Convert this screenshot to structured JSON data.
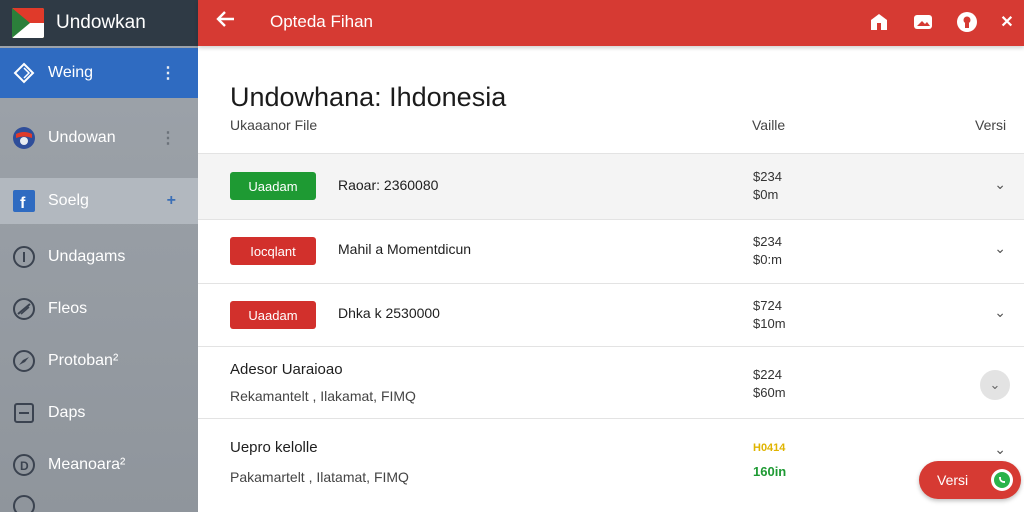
{
  "app": {
    "name": "Undowkan"
  },
  "sidebar": {
    "items": [
      {
        "label": "Weing",
        "icon": "diamond-icon"
      },
      {
        "label": "Undowan",
        "icon": "flag-circle-icon"
      },
      {
        "label": "Soelg",
        "icon": "facebook-icon"
      },
      {
        "label": "Undagams",
        "icon": "info-circle-icon"
      },
      {
        "label": "Fleos",
        "icon": "slash-circle-icon"
      },
      {
        "label": "Protoban²",
        "icon": "compass-circle-icon"
      },
      {
        "label": "Daps",
        "icon": "document-icon"
      },
      {
        "label": "Meanoara²",
        "icon": "d-circle-icon"
      }
    ]
  },
  "topbar": {
    "title": "Opteda Fihan"
  },
  "main": {
    "title": "Undowhana: Ihdonesia",
    "columns": {
      "file": "Ukaaanor File",
      "value": "Vaille",
      "version": "Versi"
    },
    "rows": [
      {
        "button": "Uaadam",
        "button_color": "#1e9a33",
        "name": "Raoar: 2360080",
        "value1": "$234",
        "value2": "$0m"
      },
      {
        "button": "Iocqlant",
        "button_color": "#d2302c",
        "name": "Mahil a Momentdicun",
        "value1": "$234",
        "value2": "$0:m"
      },
      {
        "button": "Uaadam",
        "button_color": "#d2302c",
        "name": "Dhka k 2530000",
        "value1": "$724",
        "value2": "$10m"
      }
    ],
    "plain_rows": [
      {
        "title": "Adesor Uaraioao",
        "subtitle": "Rekamantelt , Ilakamat, FIMQ",
        "value1": "$224",
        "value2": "$60m"
      },
      {
        "title": "Uepro kelolle",
        "subtitle": "Pakamartelt , Ilatamat, FIMQ",
        "value1": "H0414",
        "value2": "160in",
        "value1_color": "#e0b400",
        "value2_color": "#1e9a33"
      }
    ]
  },
  "fab": {
    "label": "Versi"
  },
  "colors": {
    "topbar": "#d63a33",
    "sidebar_active": "#2f6bc1",
    "sidebar_header": "#2f3a45"
  }
}
